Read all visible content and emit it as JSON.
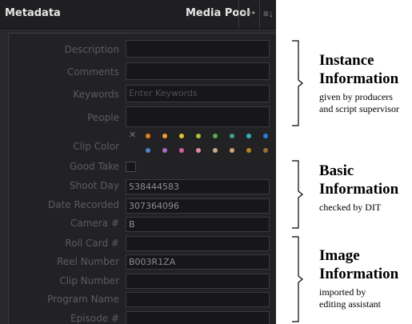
{
  "header": {
    "title": "Metadata",
    "media_pool": "Media Pool",
    "more": "•••",
    "sort": "≡↓"
  },
  "fields": [
    {
      "label": "Description",
      "value": "",
      "placeholder": ""
    },
    {
      "label": "Comments",
      "value": "",
      "placeholder": ""
    },
    {
      "label": "Keywords",
      "value": "",
      "placeholder": "Enter Keywords"
    },
    {
      "label": "People",
      "value": "",
      "placeholder": ""
    },
    {
      "label": "Clip Color"
    },
    {
      "label": "Good Take"
    },
    {
      "label": "Shoot Day",
      "value": "538444583"
    },
    {
      "label": "Date Recorded",
      "value": "307364096"
    },
    {
      "label": "Camera #",
      "value": "B"
    },
    {
      "label": "Roll Card #",
      "value": ""
    },
    {
      "label": "Reel Number",
      "value": "B003R1ZA"
    },
    {
      "label": "Clip Number",
      "value": ""
    },
    {
      "label": "Program Name",
      "value": ""
    },
    {
      "label": "Episode #",
      "value": ""
    }
  ],
  "clip_colors": {
    "row1": [
      "#e8811f",
      "#ef9f2a",
      "#e3c02a",
      "#9fc633",
      "#55ad4a",
      "#3f9a86",
      "#2bb3bf",
      "#2a7fd0"
    ],
    "row2": [
      "#4a86c8",
      "#a86dc0",
      "#d55fa2",
      "#e688a5",
      "#c9a98a",
      "#d0a27a",
      "#b7811e",
      "#9a6b3a"
    ]
  },
  "annotations": {
    "instance": {
      "title_1": "Instance",
      "title_2": "Information",
      "sub_1": "given by producers",
      "sub_2": "and script supervisor"
    },
    "basic": {
      "title_1": "Basic",
      "title_2": "Information",
      "sub_1": "checked by DIT"
    },
    "image": {
      "title_1": "Image",
      "title_2": "Information",
      "sub_1": "imported by",
      "sub_2": "editing assistant"
    }
  }
}
